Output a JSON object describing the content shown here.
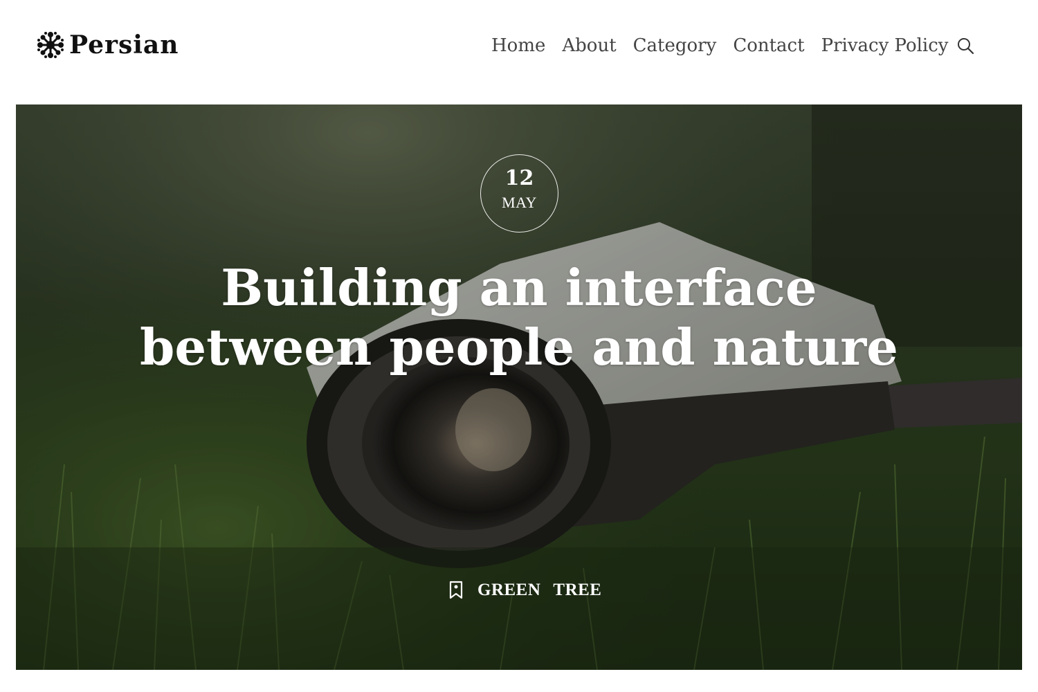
{
  "brand": {
    "name": "Persian",
    "logo_icon": "coral-tree-icon"
  },
  "nav": {
    "items": [
      {
        "label": "Home"
      },
      {
        "label": "About"
      },
      {
        "label": "Category"
      },
      {
        "label": "Contact"
      },
      {
        "label": "Privacy Policy"
      }
    ],
    "search_icon": "search-icon"
  },
  "post": {
    "date": {
      "day": "12",
      "month": "MAY"
    },
    "title": "Building an interface between people and nature",
    "tag_icon": "tag-icon",
    "tags": [
      "GREEN",
      "TREE"
    ]
  },
  "colors": {
    "text_dark": "#111111",
    "nav_text": "#444444",
    "hero_text": "#ffffff"
  }
}
